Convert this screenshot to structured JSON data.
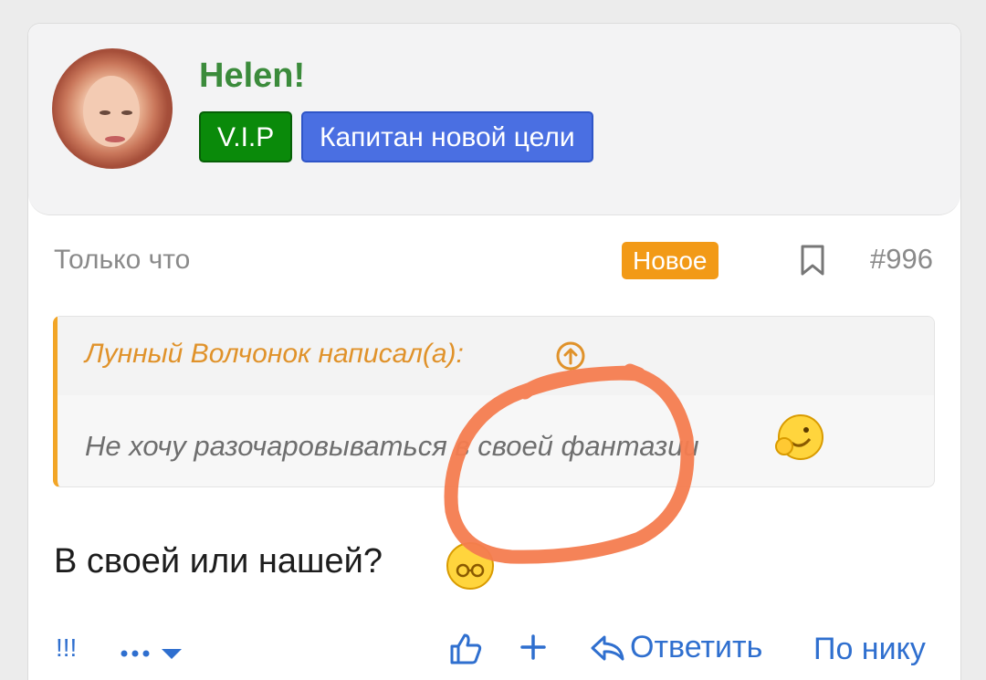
{
  "post": {
    "author": "Helen!",
    "badges": {
      "vip": "V.I.P",
      "title": "Капитан новой цели"
    },
    "time": "Только что",
    "new_label": "Новое",
    "number": "#996",
    "quote": {
      "author": "Лунный Волчонок написал(а):",
      "text": "Не хочу разочаровываться в своей фантазии"
    },
    "message": "В своей или нашей?"
  },
  "actions": {
    "report": "!!!",
    "reply": "Ответить",
    "by_nick": "По нику"
  },
  "colors": {
    "username": "#3b8b3b",
    "vip": "#0a8a0a",
    "title_badge": "#4a6fe2",
    "new_badge": "#f29a17",
    "quote_accent": "#f2a526",
    "link": "#2f6fcf",
    "annotation": "#f47c4f"
  },
  "icons": [
    "bookmark-icon",
    "arrow-up-circle-icon",
    "smiley-icon",
    "thumbs-up-icon",
    "plus-icon",
    "reply-icon",
    "more-icon",
    "caret-down-icon"
  ]
}
